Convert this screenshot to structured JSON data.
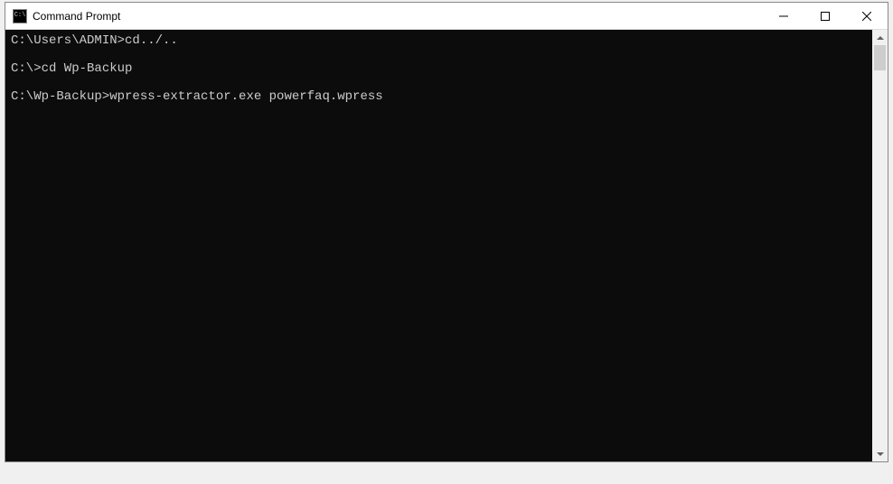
{
  "window": {
    "title": "Command Prompt"
  },
  "terminal": {
    "lines": [
      "C:\\Users\\ADMIN>cd../..",
      "C:\\>cd Wp-Backup",
      "C:\\Wp-Backup>wpress-extractor.exe powerfaq.wpress"
    ]
  }
}
